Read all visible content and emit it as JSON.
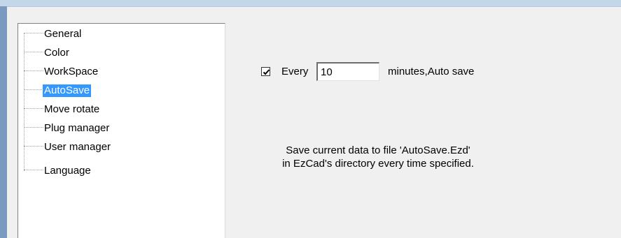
{
  "tree": {
    "items": [
      {
        "label": "General",
        "selected": false
      },
      {
        "label": "Color",
        "selected": false
      },
      {
        "label": "WorkSpace",
        "selected": false
      },
      {
        "label": "AutoSave",
        "selected": true
      },
      {
        "label": "Move rotate",
        "selected": false
      },
      {
        "label": "Plug manager",
        "selected": false
      },
      {
        "label": "User manager",
        "selected": false
      },
      {
        "label": "Language",
        "selected": false
      }
    ]
  },
  "autosave": {
    "checked": true,
    "every_label": "Every",
    "minutes_value": "10",
    "minutes_label": "minutes,Auto save",
    "description_line1": "Save current data to file 'AutoSave.Ezd'",
    "description_line2": "in EzCad's directory every time specified."
  },
  "colors": {
    "selection": "#3399ff",
    "frame": "#7b9ac0"
  }
}
